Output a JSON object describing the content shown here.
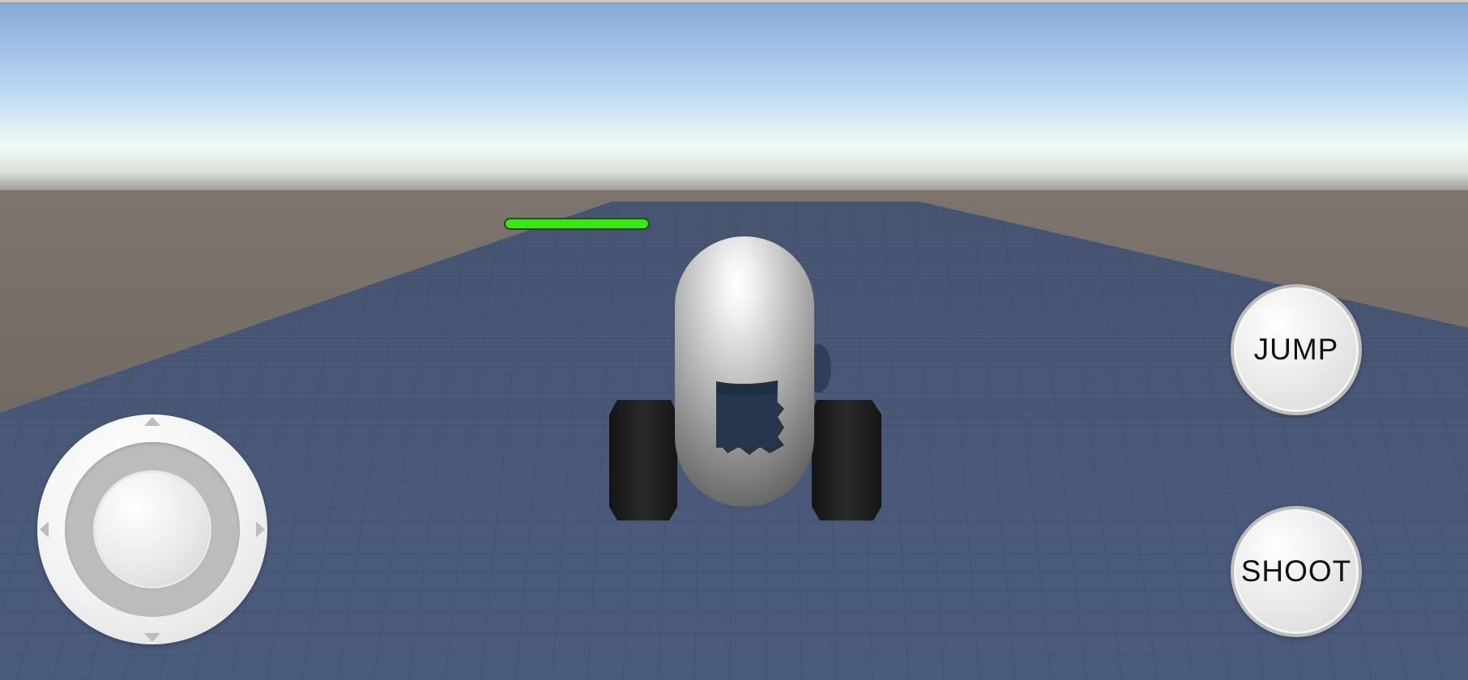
{
  "colors": {
    "sky_top": "#88a9d6",
    "sky_horizon": "#eefaf6",
    "ground": "#6b655f",
    "floor": "#4a5a7a",
    "grid_line": "#3e4d6b",
    "health_fill": "#39e61a"
  },
  "hud": {
    "health_fraction": 1.0
  },
  "controls": {
    "jump_label": "JUMP",
    "shoot_label": "SHOOT",
    "joystick_icon": "dpad-joystick-icon"
  },
  "scene": {
    "player": "capsule-tank-player"
  }
}
